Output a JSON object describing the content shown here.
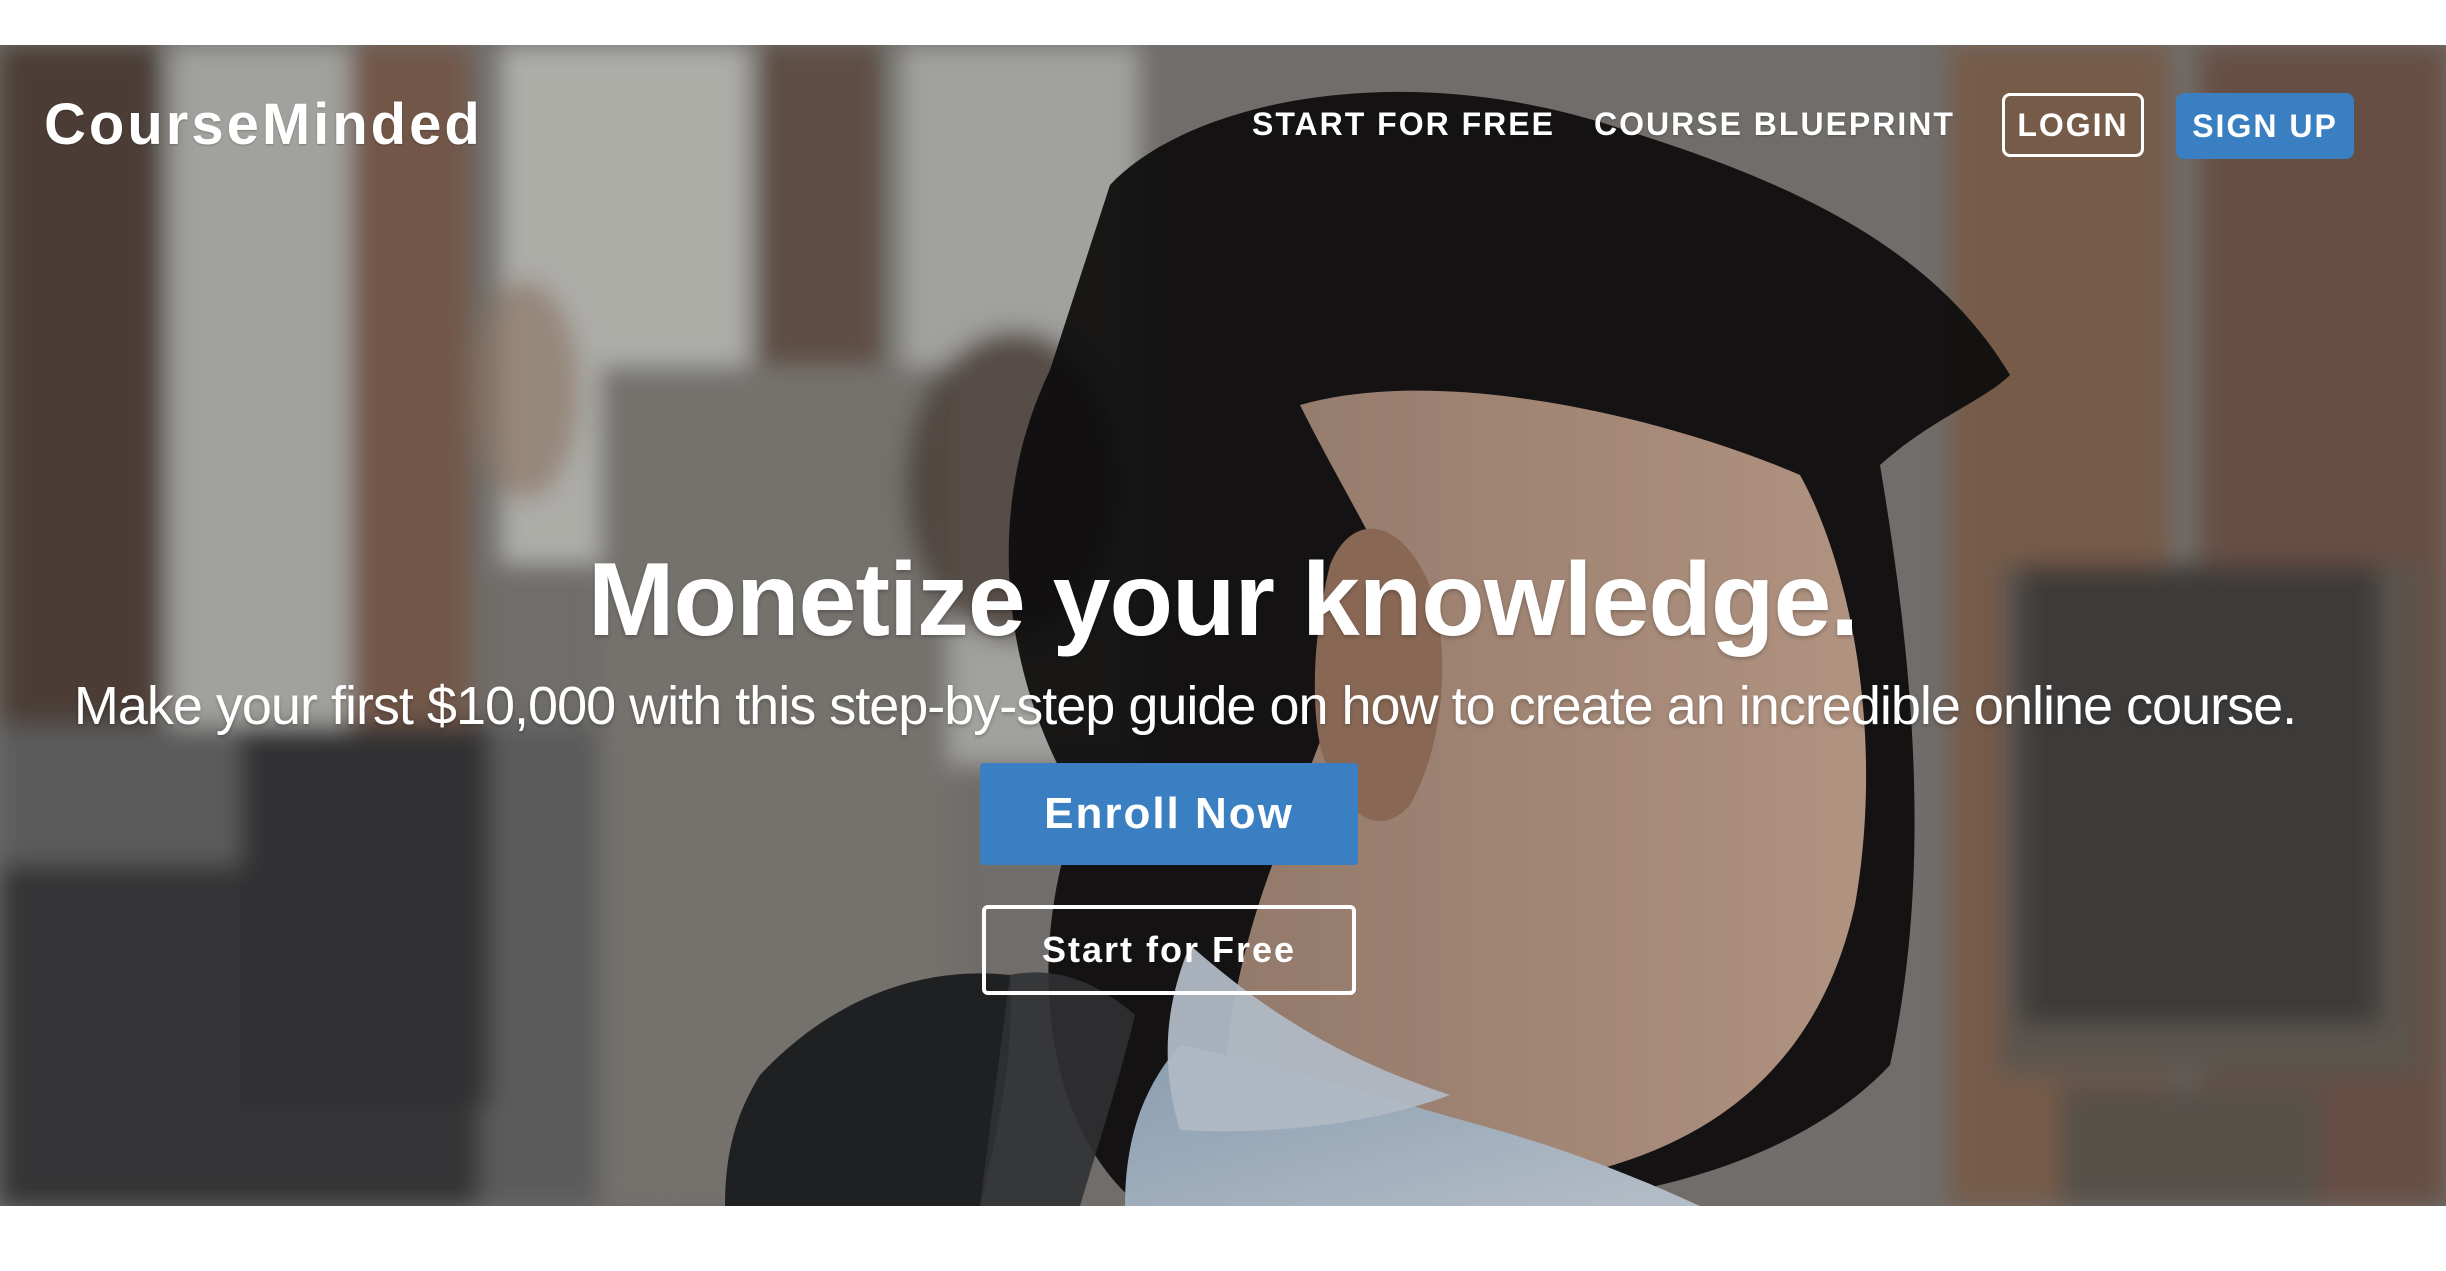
{
  "brand": {
    "name": "CourseMinded"
  },
  "nav": {
    "links": [
      {
        "label": "START FOR FREE"
      },
      {
        "label": "COURSE BLUEPRINT"
      }
    ],
    "login_label": "LOGIN",
    "signup_label": "SIGN UP"
  },
  "hero": {
    "headline": "Monetize your knowledge.",
    "subheadline": "Make your first $10,000 with this step-by-step guide on how to create an incredible online course.",
    "primary_cta": "Enroll Now",
    "secondary_cta": "Start for Free",
    "background_image": "office-man-profile-photo"
  },
  "colors": {
    "accent": "#3a7fc1",
    "text": "#ffffff",
    "page_background": "#ffffff"
  }
}
